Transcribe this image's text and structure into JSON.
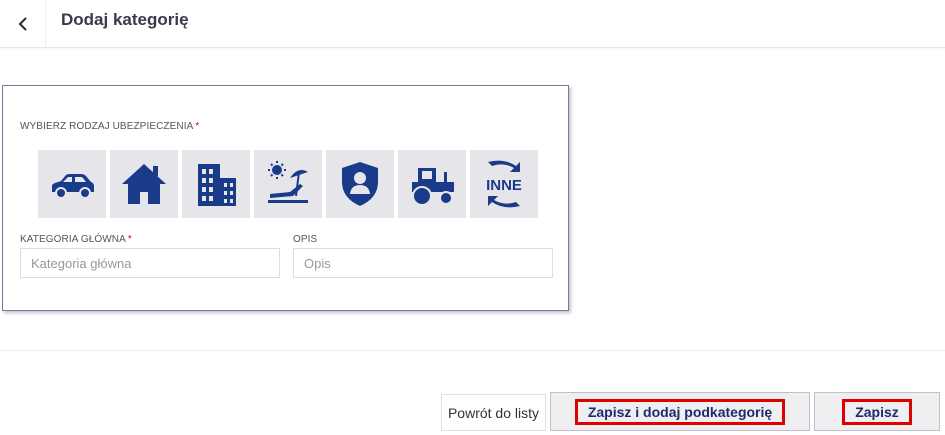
{
  "header": {
    "back_icon": "chevron-left-icon",
    "title": "Dodaj kategorię"
  },
  "form": {
    "insurance_type_label": "WYBIERZ RODZAJ UBEZPIECZENIA",
    "required_marker": "*",
    "insurance_types": [
      {
        "icon": "car-icon"
      },
      {
        "icon": "house-icon"
      },
      {
        "icon": "buildings-icon"
      },
      {
        "icon": "beach-travel-icon"
      },
      {
        "icon": "shield-person-icon"
      },
      {
        "icon": "tractor-icon"
      },
      {
        "icon": "other-icon",
        "text": "INNE"
      }
    ],
    "main_category": {
      "label": "KATEGORIA GŁÓWNA",
      "placeholder": "Kategoria główna",
      "value": ""
    },
    "description": {
      "label": "OPIS",
      "placeholder": "Opis",
      "value": ""
    }
  },
  "actions": {
    "back_to_list": "Powrót do listy",
    "save_and_add_subcategory": "Zapisz i dodaj podkategorię",
    "save": "Zapisz"
  },
  "colors": {
    "icon_navy": "#1a3a8a",
    "tile_bg": "#e6e6ea",
    "highlight_red": "#e00000",
    "required_red": "#d0021b"
  }
}
